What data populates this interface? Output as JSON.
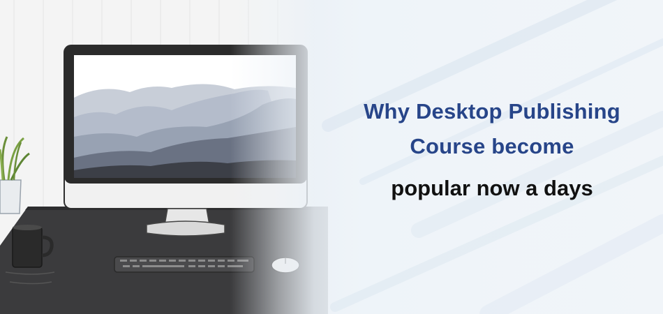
{
  "headline": {
    "line1": "Why Desktop Publishing",
    "line2": "Course become",
    "line3": "popular now a days"
  },
  "colors": {
    "title_blue": "#274589",
    "title_black": "#111111",
    "background": "#f1f5f9",
    "desk": "#3a3a3c"
  },
  "icons": [
    "desktop-monitor-icon",
    "keyboard-icon",
    "mouse-icon",
    "coffee-mug-icon",
    "potted-plant-icon"
  ]
}
